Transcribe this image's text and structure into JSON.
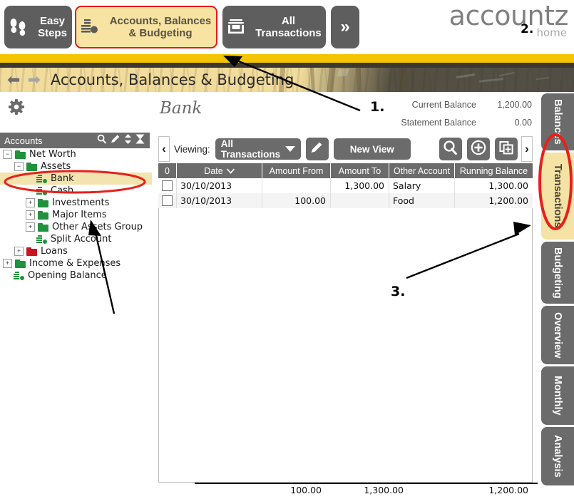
{
  "topbar": {
    "buttons": [
      {
        "id": "easy-steps",
        "label_line1": "Easy",
        "label_line2": "Steps",
        "icon": "footsteps-icon",
        "selected": false
      },
      {
        "id": "accounts-balances-budgeting",
        "label_line1": "Accounts, Balances",
        "label_line2": "& Budgeting",
        "icon": "bar-chart-coins-icon",
        "selected": true
      },
      {
        "id": "all-transactions",
        "label_line1": "All",
        "label_line2": "Transactions",
        "icon": "inbox-tray-icon",
        "selected": false
      },
      {
        "id": "more",
        "label_line1": "»",
        "label_line2": "",
        "icon": "double-chevron-right-icon",
        "selected": false
      }
    ],
    "logo_main": "accountz",
    "logo_sub": "home",
    "colors": {
      "button_bg": "#5e5e5e",
      "selected_bg": "#f7e4a2",
      "selected_border": "#e41a1a",
      "logo": "#808080"
    }
  },
  "header": {
    "back_arrow": "⬅",
    "forward_arrow": "➡",
    "title": "Accounts, Balances & Budgeting",
    "strip_color": "#f5c400"
  },
  "sidebar": {
    "gear_icon": "gear-icon",
    "panel_title": "Accounts",
    "header_icons": [
      "search-icon",
      "pencil-icon",
      "sort-updown-icon",
      "collapse-all-icon"
    ],
    "tree": [
      {
        "label": "Net Worth",
        "indent": 0,
        "expander": "minus",
        "icon": "folder-green",
        "selected": false
      },
      {
        "label": "Assets",
        "indent": 1,
        "expander": "minus",
        "icon": "folder-green",
        "selected": false
      },
      {
        "label": "Bank",
        "indent": 2,
        "expander": "none",
        "icon": "account-green",
        "selected": true
      },
      {
        "label": "Cash",
        "indent": 2,
        "expander": "none",
        "icon": "account-green",
        "selected": false
      },
      {
        "label": "Investments",
        "indent": 2,
        "expander": "plus",
        "icon": "folder-green",
        "selected": false
      },
      {
        "label": "Major Items",
        "indent": 2,
        "expander": "plus",
        "icon": "folder-green",
        "selected": false
      },
      {
        "label": "Other Assets Group",
        "indent": 2,
        "expander": "plus",
        "icon": "folder-green",
        "selected": false
      },
      {
        "label": "Split Account",
        "indent": 2,
        "expander": "none",
        "icon": "account-green",
        "selected": false
      },
      {
        "label": "Loans",
        "indent": 1,
        "expander": "plus",
        "icon": "folder-red",
        "selected": false
      },
      {
        "label": "Income & Expenses",
        "indent": 0,
        "expander": "plus",
        "icon": "folder-green",
        "selected": false
      },
      {
        "label": "Opening Balance",
        "indent": 0,
        "expander": "none",
        "icon": "account-green",
        "selected": false
      }
    ]
  },
  "main": {
    "page_title": "Bank",
    "balances": [
      {
        "label": "Current Balance",
        "value": "1,200.00"
      },
      {
        "label": "Statement Balance",
        "value": "0.00"
      }
    ],
    "toolbar": {
      "left_chevron": "‹",
      "right_chevron": "›",
      "viewing_label": "Viewing:",
      "view_selected": "All Transactions",
      "edit_icon": "pencil-icon",
      "new_view_label": "New View",
      "search_icon": "search-icon",
      "add_icon": "plus-circle-icon",
      "duplicate_icon": "copy-add-icon"
    },
    "table": {
      "columns": [
        "0",
        "Date",
        "Amount From",
        "Amount To",
        "Other Account",
        "Running Balance"
      ],
      "sort_column": "Date",
      "sort_icon": "chevron-down-icon",
      "rows": [
        {
          "checked": false,
          "date": "30/10/2013",
          "amount_from": "",
          "amount_to": "1,300.00",
          "other_account": "Salary",
          "running_balance": "1,300.00"
        },
        {
          "checked": false,
          "date": "30/10/2013",
          "amount_from": "100.00",
          "amount_to": "",
          "other_account": "Food",
          "running_balance": "1,200.00"
        }
      ],
      "totals": {
        "amount_from": "100.00",
        "amount_to": "1,300.00",
        "running_balance": "1,200.00"
      }
    }
  },
  "right_tabs": [
    {
      "label": "Balances",
      "active": false
    },
    {
      "label": "Transactions",
      "active": true
    },
    {
      "label": "Budgeting",
      "active": false
    },
    {
      "label": "Overview",
      "active": false
    },
    {
      "label": "Monthly",
      "active": false
    },
    {
      "label": "Analysis",
      "active": false
    }
  ],
  "annotations": [
    {
      "number": "1.",
      "points_to": "accounts-balances-budgeting-button"
    },
    {
      "number": "2.",
      "points_to": "accountz-logo"
    },
    {
      "number": "3.",
      "points_to": "transactions-vertical-tab"
    }
  ]
}
